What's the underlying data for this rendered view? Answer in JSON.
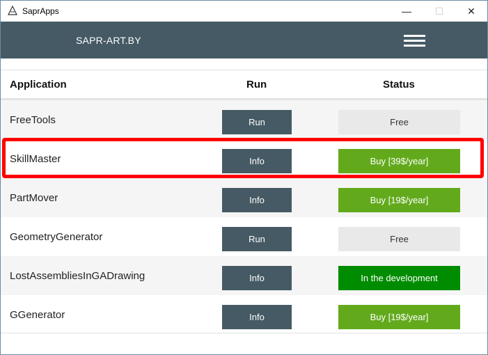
{
  "window": {
    "title": "SaprApps",
    "minimize": "—",
    "maximize": "☐",
    "close": "✕"
  },
  "header": {
    "brand": "SAPR-ART.BY"
  },
  "table": {
    "columns": {
      "application": "Application",
      "run": "Run",
      "status": "Status"
    },
    "rows": [
      {
        "name": "FreeTools",
        "action": "Run",
        "status": "Free",
        "status_type": "free"
      },
      {
        "name": "SkillMaster",
        "action": "Info",
        "status": "Buy [39$/year]",
        "status_type": "buy"
      },
      {
        "name": "PartMover",
        "action": "Info",
        "status": "Buy [19$/year]",
        "status_type": "buy"
      },
      {
        "name": "GeometryGenerator",
        "action": "Run",
        "status": "Free",
        "status_type": "free"
      },
      {
        "name": "LostAssembliesInGADrawing",
        "action": "Info",
        "status": "In the development",
        "status_type": "dev"
      },
      {
        "name": "GGenerator",
        "action": "Info",
        "status": "Buy [19$/year]",
        "status_type": "buy"
      }
    ]
  },
  "colors": {
    "header_bg": "#455a64",
    "buy": "#62aa1c",
    "development": "#008c00",
    "free": "#e9e9e9",
    "highlight": "#ff0000"
  }
}
